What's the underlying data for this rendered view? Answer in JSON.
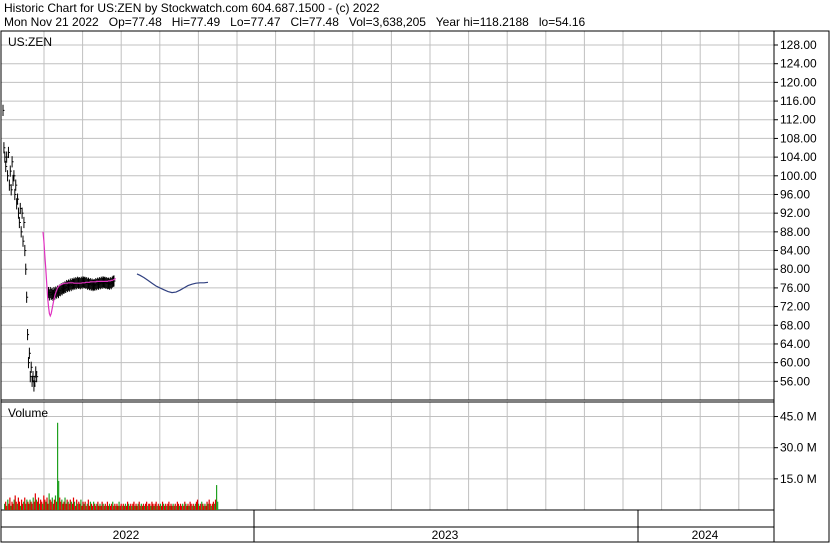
{
  "header": {
    "line1": "Historic Chart for US:ZEN by Stockwatch.com 604.687.1500 - (c) 2022",
    "line2": "Mon Nov 21 2022   Op=77.48   Hi=77.49   Lo=77.47   Cl=77.48   Vol=3,638,205   Year hi=118.2188   lo=54.16"
  },
  "chart_data": [
    {
      "type": "line",
      "title": "US:ZEN",
      "ylim": [
        52,
        131
      ],
      "y_ticks": [
        "128.00",
        "124.00",
        "120.00",
        "116.00",
        "112.00",
        "108.00",
        "104.00",
        "100.00",
        "96.00",
        "92.00",
        "88.00",
        "84.00",
        "80.00",
        "76.00",
        "72.00",
        "68.00",
        "64.00",
        "60.00",
        "56.00"
      ],
      "y_tick_values": [
        128,
        124,
        120,
        116,
        112,
        108,
        104,
        100,
        96,
        92,
        88,
        84,
        80,
        76,
        72,
        68,
        64,
        60,
        56
      ],
      "x_index_range": [
        0,
        232
      ],
      "series": [
        {
          "values": [
            114,
            106,
            104,
            102,
            104,
            100,
            105,
            98,
            101,
            97,
            103,
            99,
            100,
            96,
            98,
            94,
            95,
            92,
            90,
            93,
            88,
            92,
            86,
            90,
            84,
            80,
            74,
            66,
            60,
            62,
            57,
            59,
            56,
            57,
            55,
            56,
            58,
            57,
            null,
            null,
            null,
            null,
            null,
            null,
            null,
            null,
            null,
            null,
            null,
            null,
            75,
            74.5,
            75,
            74.6,
            74.8,
            74.4,
            75,
            74.7,
            75.1,
            74.9,
            75.3,
            75,
            75.5,
            75.4,
            75.8,
            75.6,
            76,
            75.9,
            76.2,
            76.1,
            76.5,
            76.3,
            76.6,
            76.4,
            76.8,
            76.5,
            76.9,
            76.7,
            77,
            76.8,
            77.1,
            76.9,
            77.2,
            77,
            77.1,
            76.9,
            77.2,
            77,
            77.3,
            77.1,
            77.2,
            77,
            77.1,
            76.8,
            77,
            76.7,
            76.9,
            76.6,
            76.8,
            76.5,
            76.7,
            76.6,
            76.9,
            76.7,
            77,
            76.8,
            77.1,
            76.9,
            77.2,
            77,
            77.3,
            77.1,
            77.2,
            77,
            77.1,
            76.9,
            77,
            76.8,
            77.1,
            76.9,
            77.2,
            77.4,
            77.48
          ]
        },
        {
          "values": [
            null,
            null,
            null,
            null,
            null,
            null,
            null,
            null,
            null,
            null,
            null,
            null,
            null,
            null,
            null,
            null,
            null,
            null,
            null,
            null,
            null,
            null,
            null,
            null,
            null,
            null,
            null,
            null,
            null,
            null,
            null,
            null,
            null,
            null,
            null,
            null,
            null,
            null,
            null,
            null,
            null,
            null,
            null,
            null,
            88,
            86,
            83,
            80,
            77,
            74,
            72,
            70.5,
            70,
            70.5,
            71.5,
            72.5,
            73.5,
            74.3,
            75,
            75.5,
            76,
            76.3,
            76.5,
            76.6,
            76.7,
            76.8,
            76.9,
            76.9,
            77,
            77,
            77,
            77,
            77.1,
            77.1,
            77.1,
            77.1,
            77.1,
            77.1,
            77,
            77,
            77,
            77,
            77,
            77,
            77,
            77,
            77,
            77.1,
            77.1,
            77.1,
            77.1,
            77.2,
            77.2,
            77.2,
            77.2,
            77.2,
            77.3,
            77.3,
            77.3,
            77.3,
            77.3,
            77.3,
            77.3,
            77.4,
            77.4,
            77.4,
            77.4,
            77.4,
            77.4,
            77.4,
            77.4,
            77.4,
            77.4,
            77.4,
            77.4,
            77.4,
            77.5,
            77.5,
            77.5,
            77.6,
            77.6,
            77.7,
            77.8,
            77.9,
            78
          ]
        },
        {
          "values": [
            null,
            null,
            null,
            null,
            null,
            null,
            null,
            null,
            null,
            null,
            null,
            null,
            null,
            null,
            null,
            null,
            null,
            null,
            null,
            null,
            null,
            null,
            null,
            null,
            null,
            null,
            null,
            null,
            null,
            null,
            null,
            null,
            null,
            null,
            null,
            null,
            null,
            null,
            null,
            null,
            null,
            null,
            null,
            null,
            null,
            null,
            null,
            null,
            null,
            null,
            null,
            null,
            null,
            null,
            null,
            null,
            null,
            null,
            null,
            null,
            null,
            null,
            null,
            null,
            null,
            null,
            null,
            null,
            null,
            null,
            null,
            null,
            null,
            null,
            null,
            null,
            null,
            null,
            null,
            null,
            null,
            null,
            null,
            null,
            null,
            null,
            null,
            null,
            null,
            null,
            null,
            null,
            null,
            null,
            null,
            null,
            null,
            null,
            null,
            null,
            null,
            null,
            null,
            null,
            null,
            null,
            null,
            null,
            null,
            null,
            null,
            null,
            null,
            null,
            null,
            null,
            null,
            null,
            null,
            null,
            null,
            null,
            null,
            null,
            null,
            null,
            null,
            null,
            null,
            null,
            null,
            null,
            null,
            null,
            null,
            null,
            null,
            null,
            null,
            null,
            null,
            null,
            null,
            null,
            null,
            null,
            null,
            null,
            null,
            null,
            null,
            null,
            null,
            null,
            null,
            null,
            null,
            null,
            null,
            null,
            null,
            null,
            null,
            null,
            null,
            null,
            null,
            null,
            null,
            null,
            null,
            null,
            null,
            null,
            null,
            null,
            null,
            null,
            null,
            null,
            null,
            null,
            null,
            null,
            null,
            null,
            null,
            null,
            null,
            null,
            null,
            null,
            null,
            null,
            null,
            null,
            null,
            null,
            null,
            null,
            null,
            null,
            null,
            null,
            null,
            null,
            null,
            null,
            null,
            null,
            null,
            null,
            null,
            null,
            null,
            null,
            null,
            null,
            null,
            null,
            null,
            null,
            null,
            null,
            null,
            null,
            null,
            null,
            null,
            null,
            null,
            null,
            null,
            null,
            null,
            null,
            null,
            null,
            null,
            null,
            null,
            null,
            null,
            null,
            null,
            null,
            null,
            null
          ]
        }
      ],
      "blue_series": [
        [
          137,
          79
        ],
        [
          140,
          78.7
        ],
        [
          144,
          78.2
        ],
        [
          148,
          77.6
        ],
        [
          152,
          77
        ],
        [
          156,
          76.4
        ],
        [
          160,
          76
        ],
        [
          164,
          75.6
        ],
        [
          168,
          75.2
        ],
        [
          172,
          75
        ],
        [
          176,
          75.1
        ],
        [
          180,
          75.5
        ],
        [
          184,
          76
        ],
        [
          188,
          76.5
        ],
        [
          192,
          76.8
        ],
        [
          196,
          77
        ],
        [
          200,
          77.1
        ],
        [
          204,
          77.1
        ],
        [
          208,
          77.2
        ]
      ],
      "colors": {
        "price": "#000000",
        "pink_ma": "#e030c0",
        "blue_ma": "#304080"
      }
    },
    {
      "type": "bar",
      "title": "Volume",
      "ylim": [
        0,
        52
      ],
      "y_ticks": [
        "45.0 M",
        "30.0 M",
        "15.0 M"
      ],
      "y_tick_values": [
        45,
        30,
        15
      ],
      "values": [
        3,
        4,
        2,
        5,
        3,
        6,
        2,
        4,
        3,
        5,
        7,
        4,
        3,
        6,
        4,
        2,
        5,
        3,
        4,
        6,
        3,
        5,
        4,
        3,
        5,
        4,
        3,
        6,
        4,
        8,
        5,
        4,
        6,
        3,
        5,
        4,
        3,
        7,
        5,
        4,
        6,
        3,
        8,
        5,
        4,
        6,
        3,
        5,
        7,
        4,
        42,
        14,
        6,
        4,
        5,
        3,
        4,
        6,
        3,
        5,
        4,
        3,
        5,
        4,
        3,
        6,
        4,
        2,
        5,
        3,
        4,
        3,
        5,
        2,
        4,
        3,
        4,
        2,
        3,
        5,
        2,
        4,
        3,
        2,
        4,
        3,
        2,
        3,
        4,
        2,
        3,
        2,
        4,
        3,
        2,
        3,
        2,
        4,
        2,
        3,
        2,
        3,
        4,
        2,
        3,
        2,
        3,
        2,
        4,
        2,
        3,
        2,
        3,
        2,
        3,
        2,
        4,
        3,
        2,
        3,
        2,
        3,
        4,
        2,
        3,
        2,
        3,
        4,
        2,
        3,
        2,
        3,
        2,
        3,
        4,
        2,
        3,
        3,
        2,
        4,
        3,
        2,
        3,
        4,
        2,
        3,
        2,
        3,
        2,
        4,
        3,
        2,
        3,
        2,
        3,
        4,
        2,
        3,
        2,
        3,
        2,
        3,
        2,
        4,
        3,
        2,
        3,
        2,
        3,
        2,
        4,
        3,
        2,
        3,
        2,
        4,
        3,
        2,
        3,
        2,
        3,
        4,
        5,
        3,
        2,
        3,
        4,
        3,
        2,
        3,
        2,
        4,
        3,
        5,
        3,
        2,
        3,
        4,
        3,
        5,
        12,
        4
      ],
      "colors": [
        "#e00000",
        "#20a020"
      ]
    },
    {
      "type": "table",
      "x_year_labels": [
        "2022",
        "2023",
        "2024"
      ]
    }
  ]
}
